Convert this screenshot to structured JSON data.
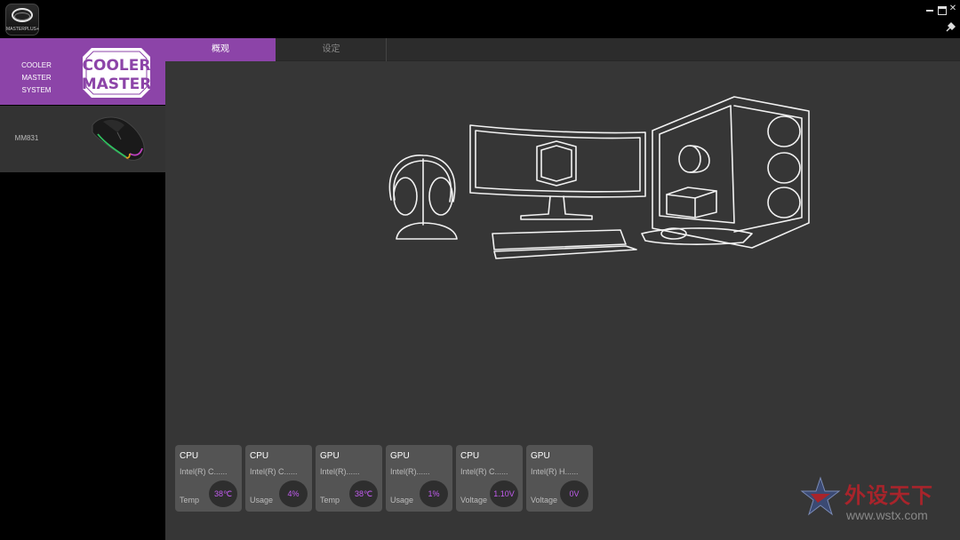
{
  "app": {
    "logo_text": "MASTERPLUS+"
  },
  "window": {
    "close_glyph": "✕"
  },
  "sidebar": {
    "devices": [
      {
        "name": "COOLER MASTER SYSTEM",
        "logo_line1": "COOLER",
        "logo_line2": "MASTER"
      },
      {
        "name": "MM831"
      }
    ]
  },
  "tabs": [
    {
      "label": "概观"
    },
    {
      "label": "设定"
    }
  ],
  "cards": [
    {
      "type": "CPU",
      "name": "Intel(R) C......",
      "metric": "Temp",
      "value": "38℃"
    },
    {
      "type": "CPU",
      "name": "Intel(R) C......",
      "metric": "Usage",
      "value": "4%"
    },
    {
      "type": "GPU",
      "name": "Intel(R)......",
      "metric": "Temp",
      "value": "38℃"
    },
    {
      "type": "GPU",
      "name": "Intel(R)......",
      "metric": "Usage",
      "value": "1%"
    },
    {
      "type": "CPU",
      "name": "Intel(R) C......",
      "metric": "Voltage",
      "value": "1.10V"
    },
    {
      "type": "GPU",
      "name": "Intel(R) H......",
      "metric": "Voltage",
      "value": "0V"
    }
  ],
  "watermark": {
    "text": "外设天下",
    "url": "www.wstx.com"
  },
  "colors": {
    "accent": "#8c44a8",
    "value_text": "#c25cf0",
    "background": "#363636"
  }
}
